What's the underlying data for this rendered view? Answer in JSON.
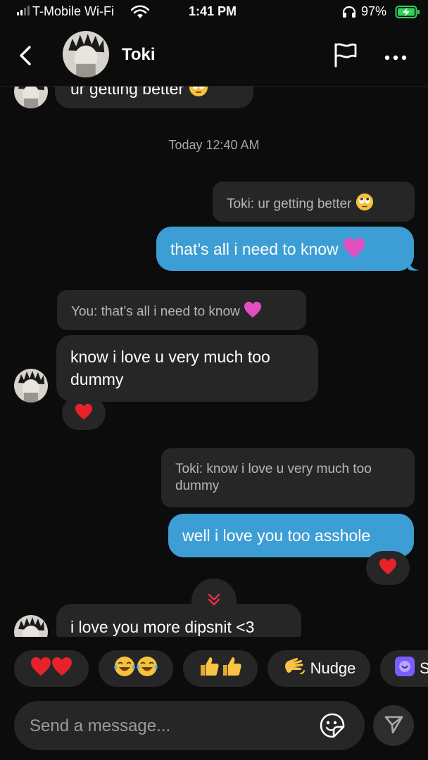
{
  "status_bar": {
    "carrier": "T-Mobile Wi-Fi",
    "time": "1:41 PM",
    "battery": "97%"
  },
  "header": {
    "contact_name": "Toki"
  },
  "messages": {
    "prev_message_partial": "ur getting better",
    "timestamp": "Today 12:40 AM",
    "reply1_quote": "Toki: ur getting better",
    "out1_text": "that’s all i need to know",
    "reply2_quote": "You: that’s all i need to know",
    "in1_text": "know i love u very much too dummy",
    "reply3_quote": "Toki: know i love u very much too dummy",
    "out2_text": "well i love you too asshole",
    "in2_text": "i love you more dipshit <3"
  },
  "quick_replies": {
    "nudge_label": "Nudge",
    "next_partial": "S"
  },
  "composer": {
    "placeholder": "Send a message..."
  },
  "colors": {
    "background": "#0c0c0d",
    "incoming_bubble": "#262627",
    "outgoing_bubble": "#3c9ed5",
    "battery_green": "#30d158"
  }
}
